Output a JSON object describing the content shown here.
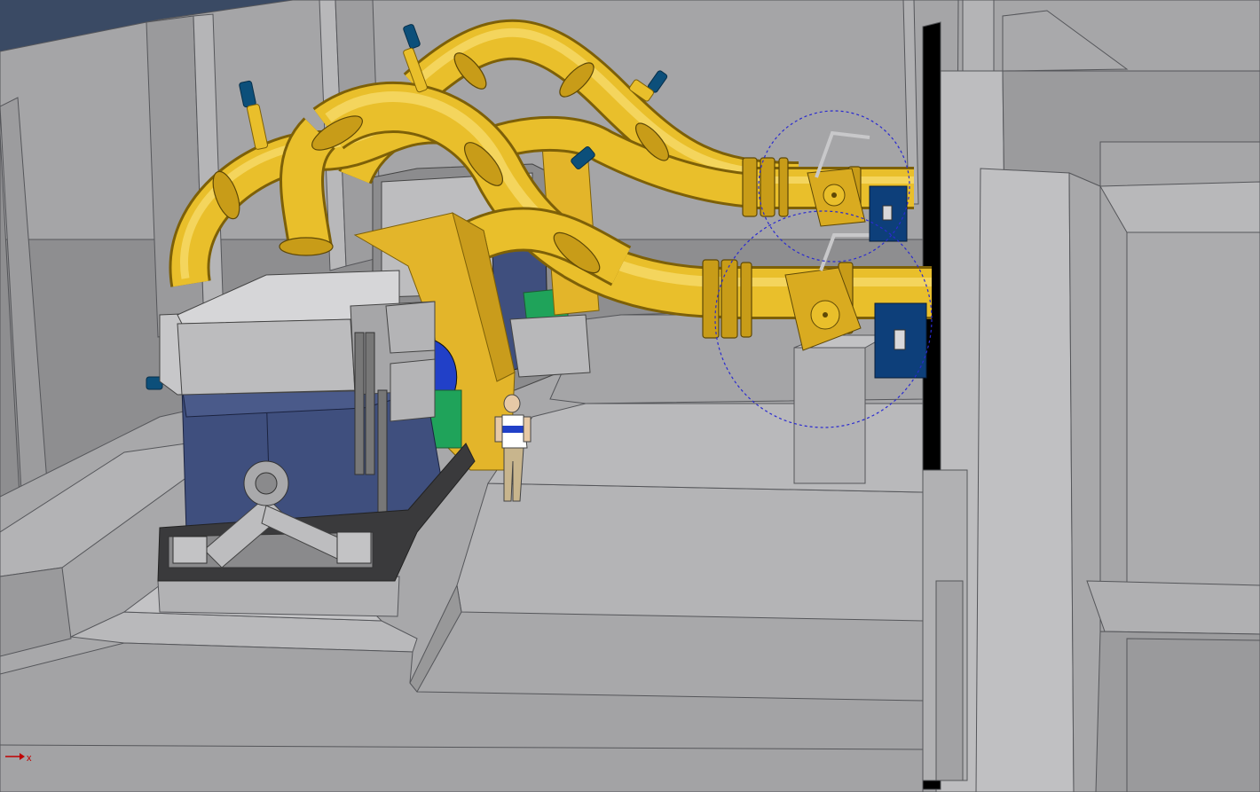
{
  "viewport": {
    "background": "#8e8e90"
  },
  "colors": {
    "floor": "#a9a9ab",
    "floor_light": "#b6b6b8",
    "floor_dark": "#8f8f91",
    "wall": "#a3a3a5",
    "wall_dark": "#7e7e80",
    "wall_light": "#bdbdbf",
    "edge": "#4f4f52",
    "pipe": "#e9bf2b",
    "pipe_dark": "#b58f12",
    "pipe_edge": "#7d6008",
    "motor_blue": "#3f4f7e",
    "valve_blue": "#0c4f7a",
    "actuator_blue": "#0d3f7a",
    "generator_green": "#1fa35a",
    "dome_blue": "#2140c8",
    "sky": "#3a4a64",
    "person_shirt": "#ffffff",
    "person_pants": "#c8b58d",
    "selection": "#2a2ad0",
    "axis_red": "#c00000"
  },
  "scene": {
    "name": "pump-station-3d-model",
    "objects": [
      "back-walls",
      "right-walls",
      "floor-plinths",
      "yellow-pipework",
      "pump-unit-front",
      "pump-unit-back",
      "isolation-valves",
      "valve-actuators",
      "human-figure",
      "selection-markers"
    ]
  },
  "triad": {
    "axis_label": "x",
    "icon": "axis-triad-icon"
  }
}
